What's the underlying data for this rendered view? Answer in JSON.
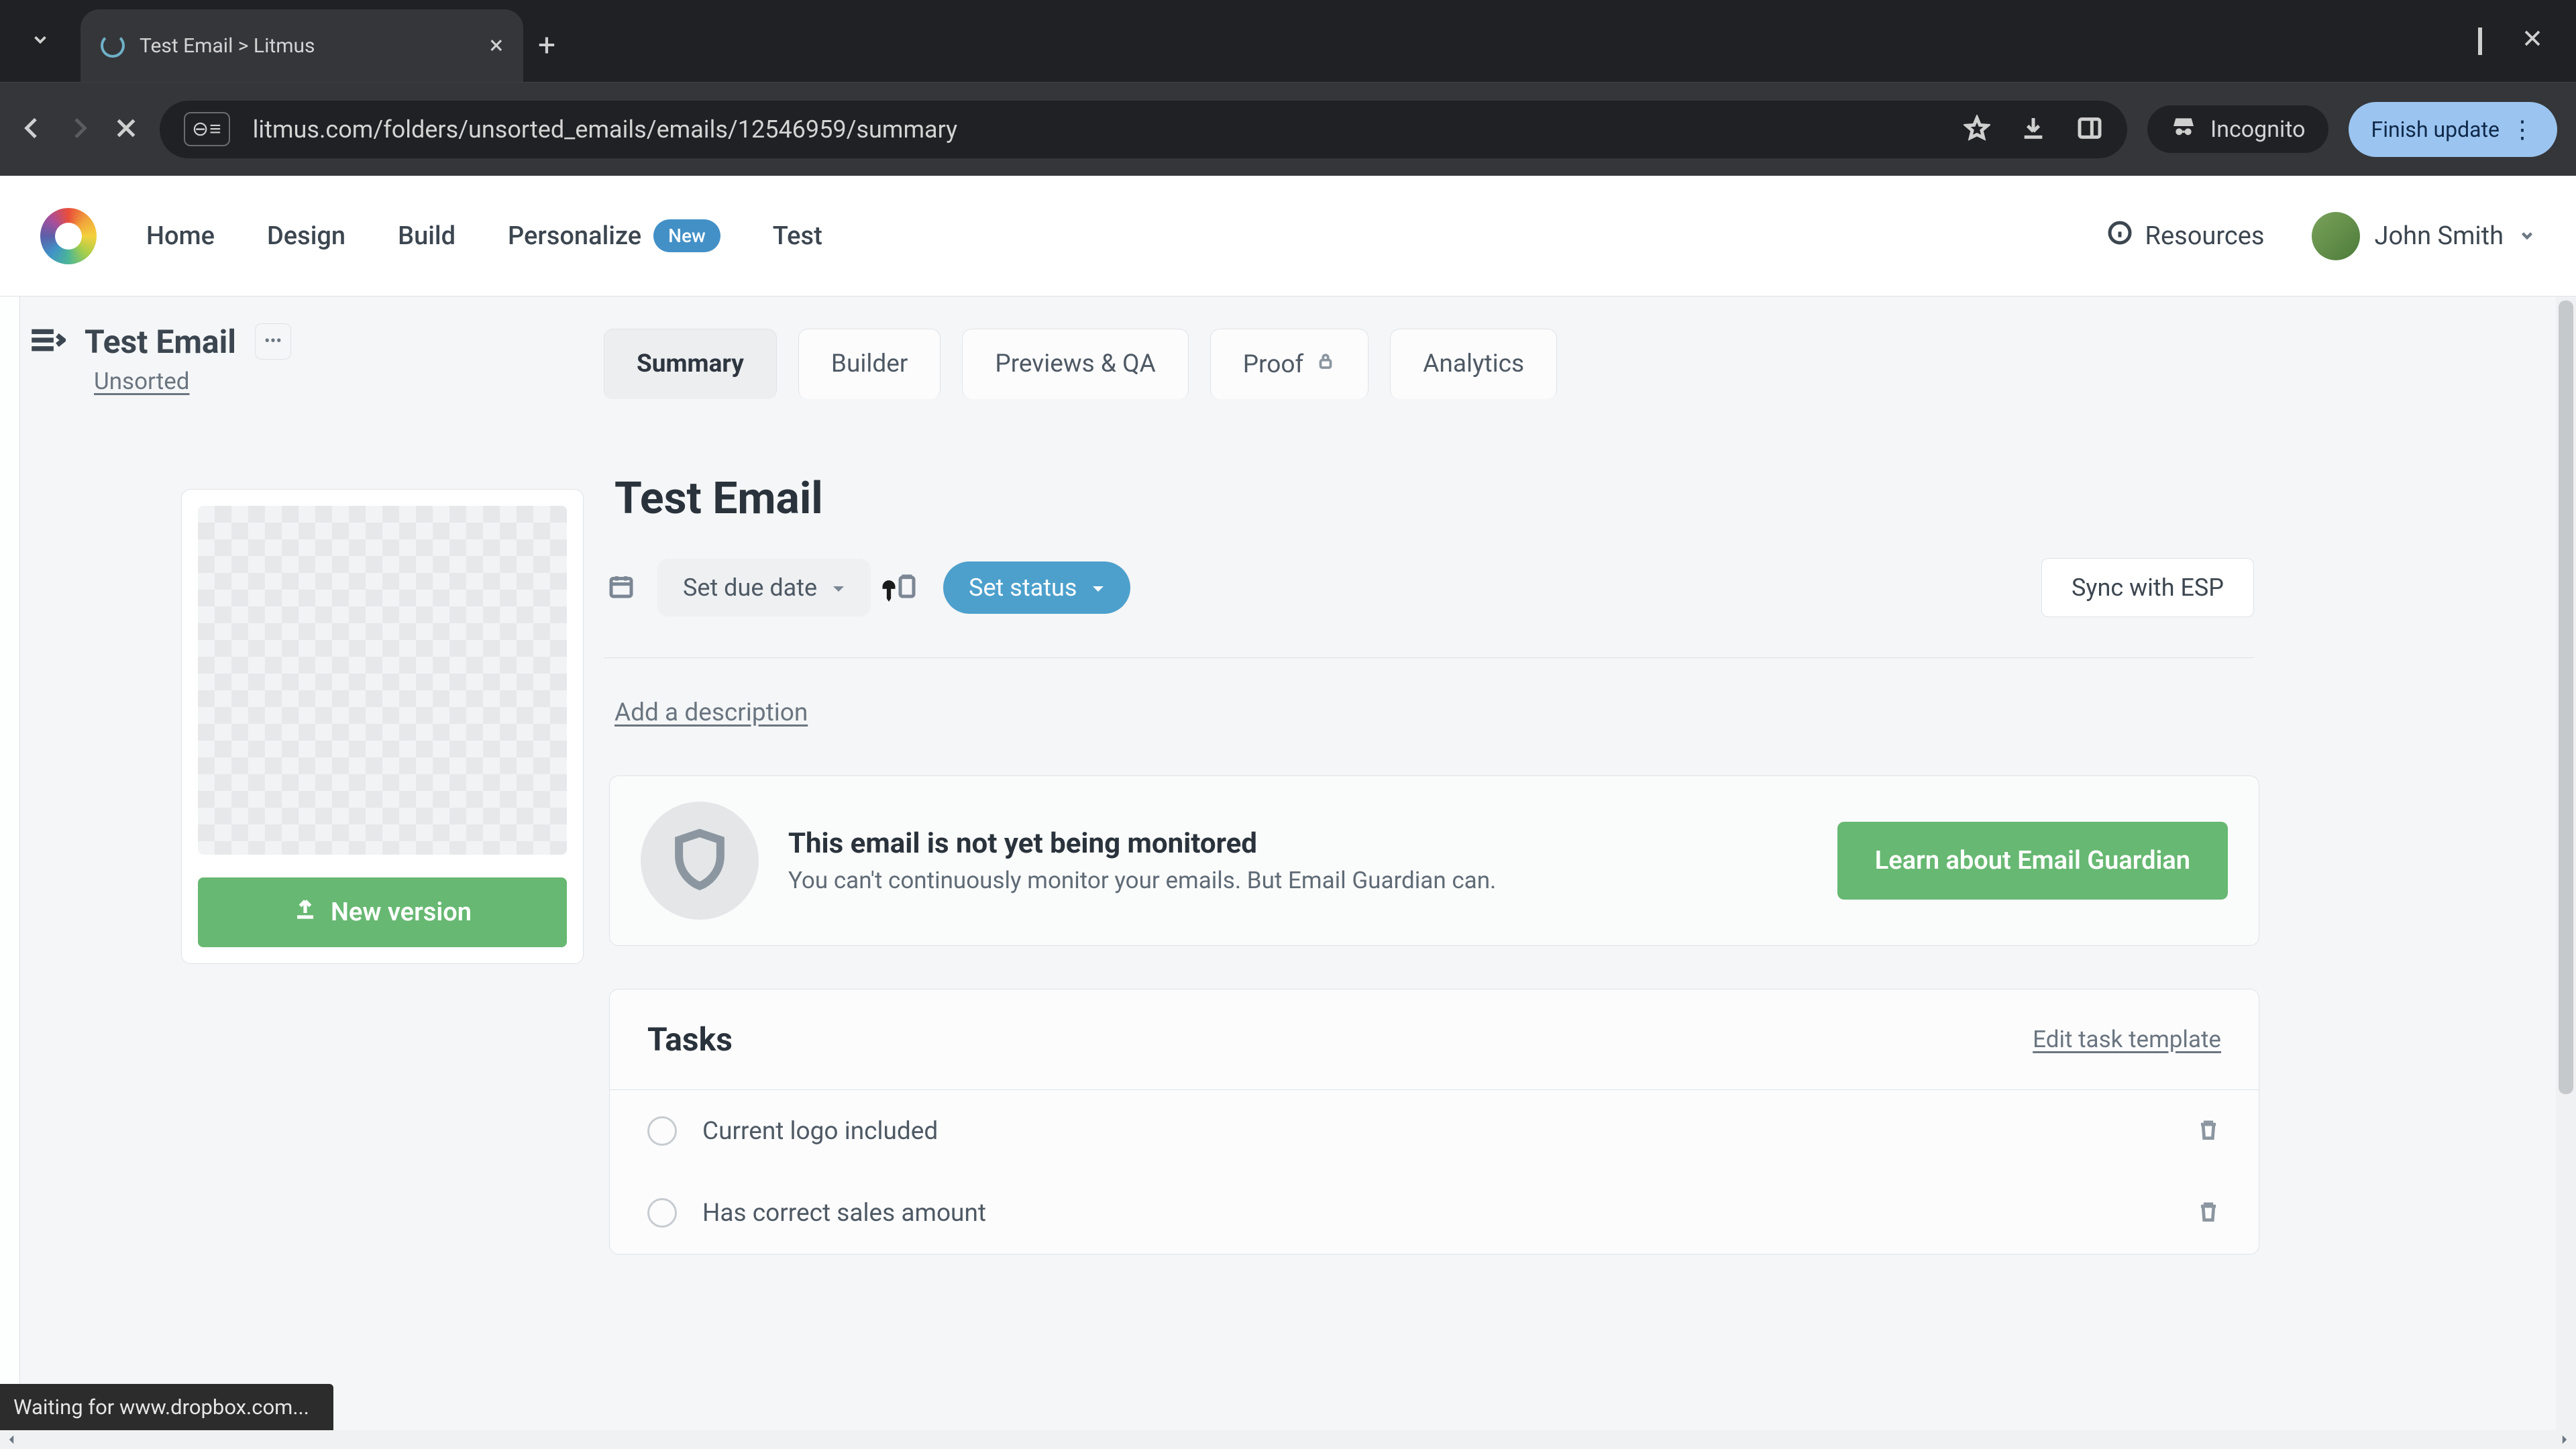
{
  "browser": {
    "tab_title": "Test Email > Litmus",
    "url": "litmus.com/folders/unsorted_emails/emails/12546959/summary",
    "incognito_label": "Incognito",
    "finish_label": "Finish update",
    "site_chip": "⊖≡"
  },
  "topnav": {
    "items": [
      "Home",
      "Design",
      "Build"
    ],
    "personalize": "Personalize",
    "new_badge": "New",
    "test": "Test",
    "resources": "Resources",
    "user_name": "John Smith"
  },
  "side": {
    "title": "Test Email",
    "folder": "Unsorted",
    "new_version": "New version"
  },
  "tabs": {
    "summary": "Summary",
    "builder": "Builder",
    "previews": "Previews & QA",
    "proof": "Proof",
    "analytics": "Analytics"
  },
  "page": {
    "title": "Test Email",
    "due_date": "Set due date",
    "set_status": "Set status",
    "sync": "Sync with ESP",
    "add_desc": "Add a description"
  },
  "guardian": {
    "title": "This email is not yet being monitored",
    "sub": "You can't continuously monitor your emails. But Email Guardian can.",
    "cta": "Learn about Email Guardian"
  },
  "tasks": {
    "heading": "Tasks",
    "edit": "Edit task template",
    "items": [
      "Current logo included",
      "Has correct sales amount"
    ]
  },
  "status_bar": "Waiting for www.dropbox.com..."
}
